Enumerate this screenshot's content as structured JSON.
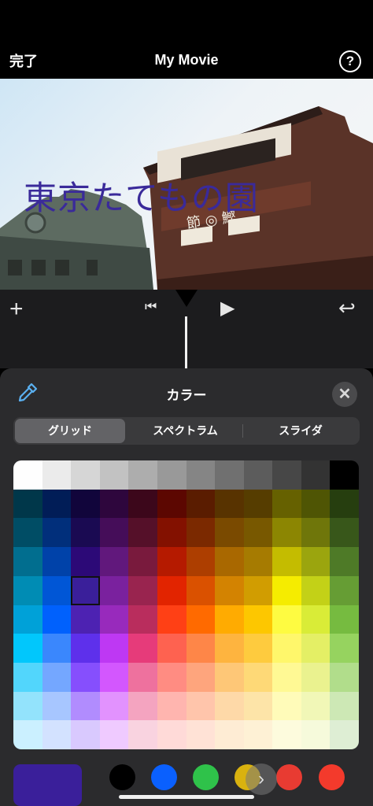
{
  "nav": {
    "done_label": "完了",
    "title": "My Movie",
    "help_label": "?"
  },
  "preview": {
    "overlay_title": "東京たてもの園"
  },
  "timeline": {
    "add_icon": "+",
    "start_icon": "⏮",
    "play_icon": "▶",
    "undo_icon": "↩"
  },
  "panel": {
    "title": "カラー",
    "close_label": "✕",
    "tabs": [
      {
        "label": "グリッド",
        "active": true
      },
      {
        "label": "スペクトラム",
        "active": false
      },
      {
        "label": "スライダ",
        "active": false
      }
    ],
    "selected_color": "#3a1f9a",
    "selected_cell": {
      "row": 4,
      "col": 2
    },
    "grid": [
      [
        "#fefefe",
        "#ebebeb",
        "#d6d6d6",
        "#c2c2c2",
        "#adadad",
        "#999999",
        "#858585",
        "#707070",
        "#5c5c5c",
        "#474747",
        "#333333",
        "#000000"
      ],
      [
        "#00374a",
        "#011d57",
        "#11053b",
        "#2e063d",
        "#3c071b",
        "#5c0701",
        "#5a1c00",
        "#583300",
        "#563d00",
        "#666100",
        "#4f5504",
        "#263e0f"
      ],
      [
        "#004d65",
        "#012f7b",
        "#1a0a52",
        "#450d59",
        "#551029",
        "#831100",
        "#7b2900",
        "#7a4a00",
        "#785800",
        "#8c8602",
        "#6f760a",
        "#38571a"
      ],
      [
        "#016e8f",
        "#0042a9",
        "#2c0977",
        "#61187c",
        "#791a3d",
        "#b51a00",
        "#ad3e00",
        "#a96800",
        "#a67b01",
        "#c4bc00",
        "#9ba50e",
        "#4e7a27"
      ],
      [
        "#008cb4",
        "#0056d6",
        "#371a94",
        "#7a219e",
        "#99244f",
        "#e22400",
        "#da5100",
        "#d38301",
        "#d19d01",
        "#f5ec00",
        "#c3d117",
        "#669d34"
      ],
      [
        "#00a1d8",
        "#0061fd",
        "#4d22b2",
        "#982abc",
        "#b92d5d",
        "#ff4015",
        "#ff6a00",
        "#ffab01",
        "#fdc700",
        "#fefb41",
        "#d9ec37",
        "#76bb40"
      ],
      [
        "#01c7fc",
        "#3a87fd",
        "#5e30eb",
        "#be38f3",
        "#e63b7a",
        "#fe6250",
        "#fe8648",
        "#feb43f",
        "#fecb3e",
        "#fff76b",
        "#e4ef65",
        "#96d35f"
      ],
      [
        "#52d6fc",
        "#74a7ff",
        "#864ffd",
        "#d357fe",
        "#ee719e",
        "#ff8c82",
        "#fea57d",
        "#fec777",
        "#fed977",
        "#fff994",
        "#eaf28f",
        "#b1dd8b"
      ],
      [
        "#93e3fc",
        "#a7c6ff",
        "#b18cfe",
        "#e292fe",
        "#f4a4c0",
        "#ffb5af",
        "#ffc5ab",
        "#fed9a8",
        "#fde4a8",
        "#fffbb9",
        "#f1f7b7",
        "#cde8b5"
      ],
      [
        "#cbf0ff",
        "#d3e2ff",
        "#d9c9fe",
        "#efcaff",
        "#f9d3e0",
        "#ffdad8",
        "#ffe2d6",
        "#feecd4",
        "#fef1d5",
        "#fdfbdd",
        "#f6fadb",
        "#deeed4"
      ]
    ],
    "presets": [
      {
        "name": "black",
        "color": "#000000"
      },
      {
        "name": "blue",
        "color": "#0a60fe"
      },
      {
        "name": "green",
        "color": "#2fc24a"
      },
      {
        "name": "yellow",
        "color": "#d9b20f"
      },
      {
        "name": "red",
        "color": "#e83b32"
      },
      {
        "name": "orange-red",
        "color": "#f33a2c"
      }
    ],
    "more_icon": "›"
  }
}
